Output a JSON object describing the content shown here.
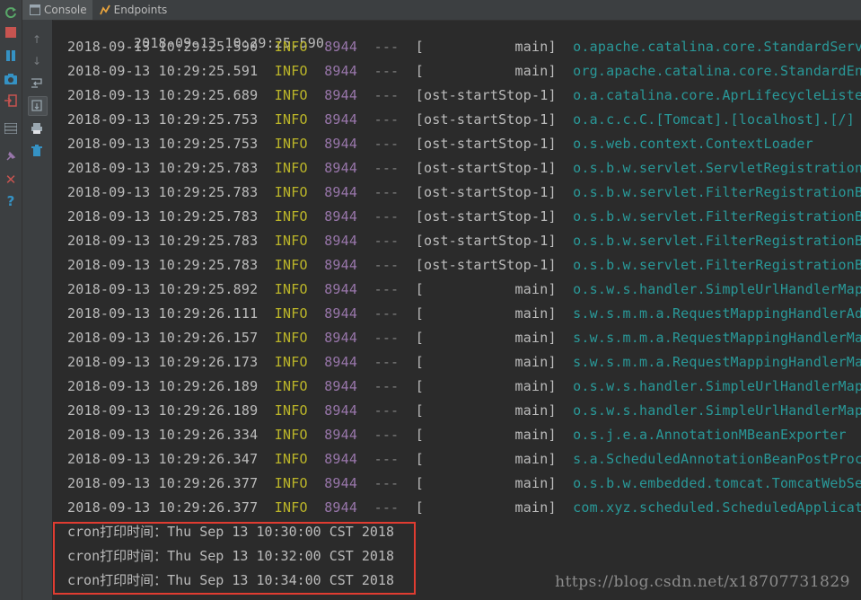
{
  "tabs": [
    {
      "label": "Console",
      "selected": true,
      "icon": "console-icon"
    },
    {
      "label": "Endpoints",
      "selected": false,
      "icon": "endpoints-icon"
    }
  ],
  "log_lines": [
    {
      "date": "2018-09-13 10:29:25.590",
      "level": "INFO",
      "pid": "8944",
      "sep": "---",
      "thread": "[           main]",
      "logger": "o.apache.catalina.core.StandardService"
    },
    {
      "date": "2018-09-13 10:29:25.591",
      "level": "INFO",
      "pid": "8944",
      "sep": "---",
      "thread": "[           main]",
      "logger": "org.apache.catalina.core.StandardEngine"
    },
    {
      "date": "2018-09-13 10:29:25.689",
      "level": "INFO",
      "pid": "8944",
      "sep": "---",
      "thread": "[ost-startStop-1]",
      "logger": "o.a.catalina.core.AprLifecycleListener"
    },
    {
      "date": "2018-09-13 10:29:25.753",
      "level": "INFO",
      "pid": "8944",
      "sep": "---",
      "thread": "[ost-startStop-1]",
      "logger": "o.a.c.c.C.[Tomcat].[localhost].[/]"
    },
    {
      "date": "2018-09-13 10:29:25.753",
      "level": "INFO",
      "pid": "8944",
      "sep": "---",
      "thread": "[ost-startStop-1]",
      "logger": "o.s.web.context.ContextLoader"
    },
    {
      "date": "2018-09-13 10:29:25.783",
      "level": "INFO",
      "pid": "8944",
      "sep": "---",
      "thread": "[ost-startStop-1]",
      "logger": "o.s.b.w.servlet.ServletRegistrationBean"
    },
    {
      "date": "2018-09-13 10:29:25.783",
      "level": "INFO",
      "pid": "8944",
      "sep": "---",
      "thread": "[ost-startStop-1]",
      "logger": "o.s.b.w.servlet.FilterRegistrationBean"
    },
    {
      "date": "2018-09-13 10:29:25.783",
      "level": "INFO",
      "pid": "8944",
      "sep": "---",
      "thread": "[ost-startStop-1]",
      "logger": "o.s.b.w.servlet.FilterRegistrationBean"
    },
    {
      "date": "2018-09-13 10:29:25.783",
      "level": "INFO",
      "pid": "8944",
      "sep": "---",
      "thread": "[ost-startStop-1]",
      "logger": "o.s.b.w.servlet.FilterRegistrationBean"
    },
    {
      "date": "2018-09-13 10:29:25.783",
      "level": "INFO",
      "pid": "8944",
      "sep": "---",
      "thread": "[ost-startStop-1]",
      "logger": "o.s.b.w.servlet.FilterRegistrationBean"
    },
    {
      "date": "2018-09-13 10:29:25.892",
      "level": "INFO",
      "pid": "8944",
      "sep": "---",
      "thread": "[           main]",
      "logger": "o.s.w.s.handler.SimpleUrlHandlerMapping"
    },
    {
      "date": "2018-09-13 10:29:26.111",
      "level": "INFO",
      "pid": "8944",
      "sep": "---",
      "thread": "[           main]",
      "logger": "s.w.s.m.m.a.RequestMappingHandlerAdapter"
    },
    {
      "date": "2018-09-13 10:29:26.157",
      "level": "INFO",
      "pid": "8944",
      "sep": "---",
      "thread": "[           main]",
      "logger": "s.w.s.m.m.a.RequestMappingHandlerMapping"
    },
    {
      "date": "2018-09-13 10:29:26.173",
      "level": "INFO",
      "pid": "8944",
      "sep": "---",
      "thread": "[           main]",
      "logger": "s.w.s.m.m.a.RequestMappingHandlerMapping"
    },
    {
      "date": "2018-09-13 10:29:26.189",
      "level": "INFO",
      "pid": "8944",
      "sep": "---",
      "thread": "[           main]",
      "logger": "o.s.w.s.handler.SimpleUrlHandlerMapping"
    },
    {
      "date": "2018-09-13 10:29:26.189",
      "level": "INFO",
      "pid": "8944",
      "sep": "---",
      "thread": "[           main]",
      "logger": "o.s.w.s.handler.SimpleUrlHandlerMapping"
    },
    {
      "date": "2018-09-13 10:29:26.334",
      "level": "INFO",
      "pid": "8944",
      "sep": "---",
      "thread": "[           main]",
      "logger": "o.s.j.e.a.AnnotationMBeanExporter"
    },
    {
      "date": "2018-09-13 10:29:26.347",
      "level": "INFO",
      "pid": "8944",
      "sep": "---",
      "thread": "[           main]",
      "logger": "s.a.ScheduledAnnotationBeanPostProcessor"
    },
    {
      "date": "2018-09-13 10:29:26.377",
      "level": "INFO",
      "pid": "8944",
      "sep": "---",
      "thread": "[           main]",
      "logger": "o.s.b.w.embedded.tomcat.TomcatWebServer"
    },
    {
      "date": "2018-09-13 10:29:26.377",
      "level": "INFO",
      "pid": "8944",
      "sep": "---",
      "thread": "[           main]",
      "logger": "com.xyz.scheduled.ScheduledApplication"
    }
  ],
  "cron_lines": [
    "cron打印时间：Thu Sep 13 10:30:00 CST 2018",
    "cron打印时间：Thu Sep 13 10:32:00 CST 2018",
    "cron打印时间：Thu Sep 13 10:34:00 CST 2018"
  ],
  "watermark": "https://blog.csdn.net/x18707731829",
  "colors": {
    "background": "#2b2b2b",
    "info": "#bbb529",
    "pid": "#9876aa",
    "logger": "#299999",
    "highlight_border": "#e03c31"
  },
  "left_toolbar_icons": [
    "rerun-icon",
    "stop-icon",
    "pause-icon",
    "camera-icon",
    "exit-icon",
    "layout-icon",
    "pin-icon",
    "close-icon",
    "help-icon"
  ],
  "side_toolbar_icons": [
    "scroll-up-icon",
    "scroll-down-icon",
    "soft-wrap-icon",
    "scroll-to-end-icon",
    "print-icon",
    "trash-icon"
  ]
}
